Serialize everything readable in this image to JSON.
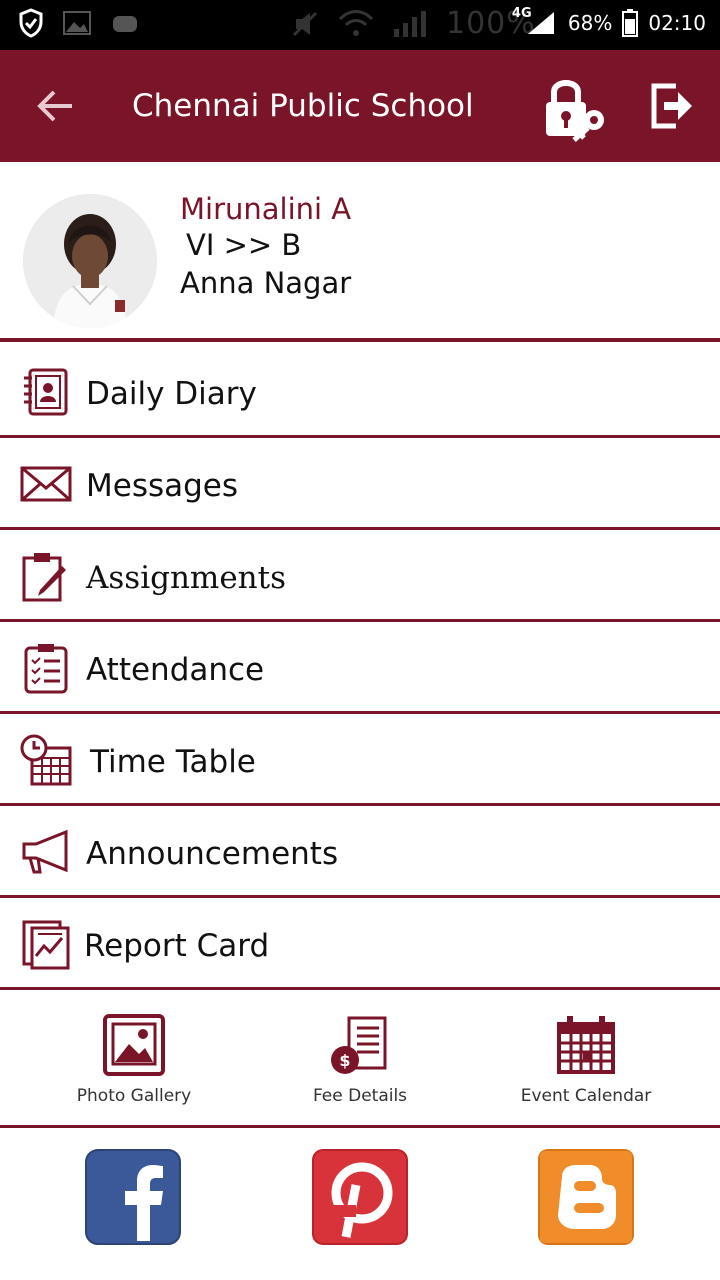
{
  "status_bar": {
    "ghost_text": "100%",
    "battery": "68%",
    "time": "02:10",
    "network": "4G",
    "icons": [
      "shield-icon",
      "image-icon",
      "robot-icon",
      "mute-icon",
      "wifi-icon",
      "signal-icon",
      "battery-icon"
    ]
  },
  "app_bar": {
    "title": "Chennai Public School",
    "back_icon": "arrow-left-icon",
    "lock_icon": "lock-key-icon",
    "logout_icon": "logout-icon"
  },
  "profile": {
    "name": "Mirunalini A",
    "class": "VI >> B",
    "branch": "Anna Nagar"
  },
  "menu": [
    {
      "label": "Daily Diary",
      "icon": "diary-icon"
    },
    {
      "label": "Messages",
      "icon": "envelope-icon"
    },
    {
      "label": "Assignments",
      "icon": "clipboard-pencil-icon"
    },
    {
      "label": "Attendance",
      "icon": "checklist-icon"
    },
    {
      "label": "Time Table",
      "icon": "clock-calendar-icon"
    },
    {
      "label": "Announcements",
      "icon": "megaphone-icon"
    },
    {
      "label": "Report Card",
      "icon": "report-chart-icon"
    }
  ],
  "quick_links": [
    {
      "label": "Photo Gallery",
      "icon": "photo-gallery-icon"
    },
    {
      "label": "Fee Details",
      "icon": "fee-details-icon"
    },
    {
      "label": "Event Calendar",
      "icon": "event-calendar-icon"
    }
  ],
  "social": [
    {
      "icon": "facebook-icon",
      "color": "#3b5998"
    },
    {
      "icon": "pinterest-icon",
      "color": "#d8323a"
    },
    {
      "icon": "blogger-icon",
      "color": "#f08c2a"
    }
  ],
  "colors": {
    "primary": "#7a1428",
    "status_bar": "#000000",
    "background": "#ffffff"
  }
}
